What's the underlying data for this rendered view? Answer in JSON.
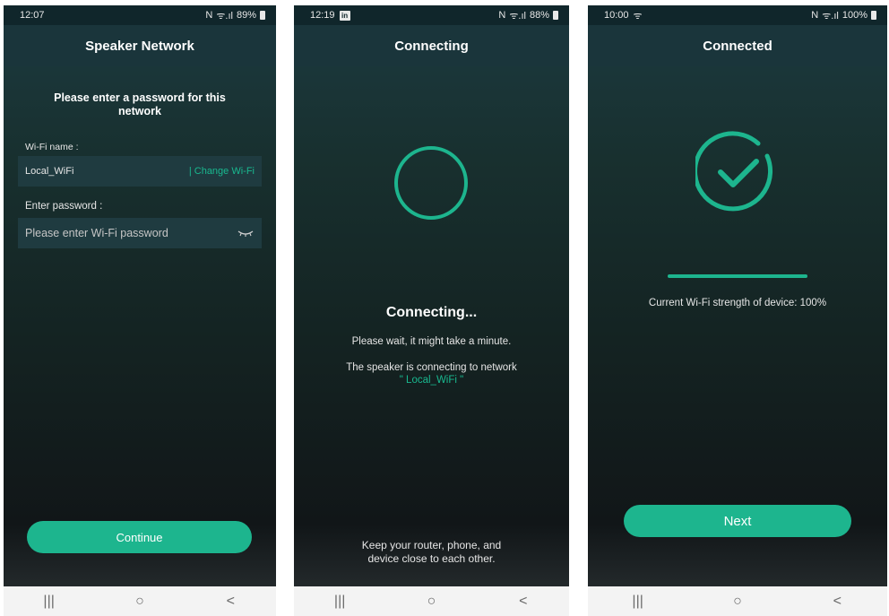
{
  "colors": {
    "accent": "#1db58e",
    "header_bg": "#1a353b",
    "field_bg": "#1f3b40"
  },
  "nav": {
    "recents": "|||",
    "home": "○",
    "back": "<"
  },
  "screen1": {
    "status": {
      "time": "12:07",
      "icons": "N",
      "signal": "ᯤ.ıl",
      "battery": "89%"
    },
    "title": "Speaker Network",
    "prompt": "Please enter a password for this network",
    "wifi_label": "Wi-Fi name :",
    "wifi_value": "Local_WiFi",
    "change_wifi": "| Change Wi-Fi",
    "password_label": "Enter password :",
    "password_placeholder": "Please enter Wi-Fi password",
    "eye_icon": "eye-closed-icon",
    "continue_label": "Continue"
  },
  "screen2": {
    "status": {
      "time": "12:19",
      "app_icon": "in",
      "icons": "N",
      "signal": "ᯤ.ıl",
      "battery": "88%"
    },
    "title": "Connecting",
    "heading": "Connecting...",
    "wait_text": "Please wait, it might take a minute.",
    "connecting_text": "The speaker is connecting to network",
    "network_name": "\" Local_WiFi \"",
    "hint_line1": "Keep your router, phone, and",
    "hint_line2": "device close to each other."
  },
  "screen3": {
    "status": {
      "time": "10:00",
      "wifi": "ᯤ",
      "icons": "N",
      "signal": "ᯤ.ıl",
      "battery": "100%"
    },
    "title": "Connected",
    "strength_percent": 100,
    "strength_text": "Current Wi-Fi strength of device: 100%",
    "next_label": "Next"
  }
}
